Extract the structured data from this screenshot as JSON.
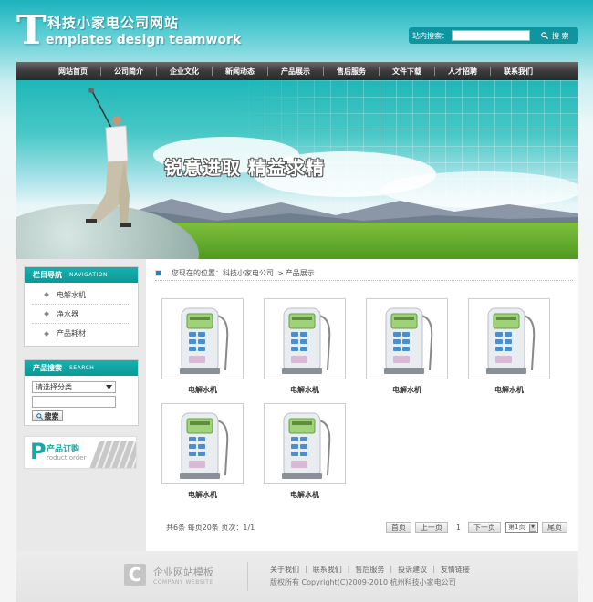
{
  "header": {
    "logo_mark": "T",
    "title_cn": "科技小家电公司网站",
    "title_en": "emplates design teamwork",
    "search_label": "站内搜索：",
    "search_button": "搜 索"
  },
  "nav": {
    "items": [
      "网站首页",
      "公司简介",
      "企业文化",
      "新闻动态",
      "产品展示",
      "售后服务",
      "文件下载",
      "人才招聘",
      "联系我们"
    ]
  },
  "banner": {
    "slogan": "锐意进取 精益求精"
  },
  "sidebar": {
    "nav_box": {
      "title": "栏目导航",
      "title_en": "NAVIGATION",
      "items": [
        "电解水机",
        "净水器",
        "产品耗材"
      ]
    },
    "search_box": {
      "title": "产品搜索",
      "title_en": "SEARCH",
      "select_value": "请选择分类",
      "button": "搜索"
    },
    "order_box": {
      "mark": "P",
      "title": "产品订购",
      "title_en": "roduct order"
    }
  },
  "breadcrumb": {
    "prefix": "您现在的位置：",
    "home": "科技小家电公司",
    "separator": ">",
    "current": "产品展示"
  },
  "products": [
    {
      "name": "电解水机"
    },
    {
      "name": "电解水机"
    },
    {
      "name": "电解水机"
    },
    {
      "name": "电解水机"
    },
    {
      "name": "电解水机"
    },
    {
      "name": "电解水机"
    }
  ],
  "pagination": {
    "info": "共6条  每页20条  页次：1/1",
    "first": "首页",
    "prev": "上一页",
    "current_page": "1",
    "next": "下一页",
    "page_select": "第1页",
    "last": "尾页"
  },
  "footer": {
    "logo_mark": "C",
    "logo_cn": "企业网站模板",
    "logo_en": "COMPANY WEBSITE",
    "links": [
      "关于我们",
      "联系我们",
      "售后服务",
      "投诉建议",
      "友情链接"
    ],
    "copyright": "版权所有  Copyright(C)2009-2010 杭州科技小家电公司"
  },
  "colors": {
    "accent": "#17b0ae",
    "nav_bg": "#3b3b3b",
    "header_bg": "#1bb3bd"
  }
}
